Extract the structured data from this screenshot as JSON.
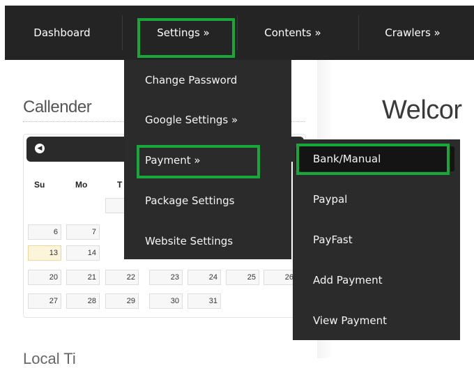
{
  "nav": {
    "items": [
      {
        "label": "Dashboard"
      },
      {
        "label": "Settings »"
      },
      {
        "label": "Contents »"
      },
      {
        "label": "Crawlers »"
      }
    ]
  },
  "settings_menu": {
    "items": [
      {
        "label": "Change Password"
      },
      {
        "label": "Google Settings »"
      },
      {
        "label": "Payment »"
      },
      {
        "label": "Package Settings"
      },
      {
        "label": "Website Settings"
      }
    ]
  },
  "payment_menu": {
    "items": [
      {
        "label": "Bank/Manual"
      },
      {
        "label": "Paypal"
      },
      {
        "label": "PayFast"
      },
      {
        "label": "Add Payment"
      },
      {
        "label": "View Payment"
      }
    ]
  },
  "sidebar": {
    "calendar_title": "Callender",
    "weekdays": [
      "Su",
      "Mo",
      "T"
    ],
    "days": {
      "row2": [
        "6",
        "7"
      ],
      "row3": [
        "13",
        "14"
      ],
      "row4": [
        "20",
        "21",
        "22",
        "23",
        "24",
        "25",
        "26"
      ],
      "row5": [
        "27",
        "28",
        "29",
        "30",
        "31"
      ]
    },
    "bottom_fragment": "Local Ti"
  },
  "main": {
    "welcome_text": "Welcor"
  },
  "colors": {
    "navbar_bg": "#242424",
    "dropdown_bg": "#2b2b2b",
    "highlight_green": "#19a63a",
    "today_bg": "#fcf5dc"
  }
}
